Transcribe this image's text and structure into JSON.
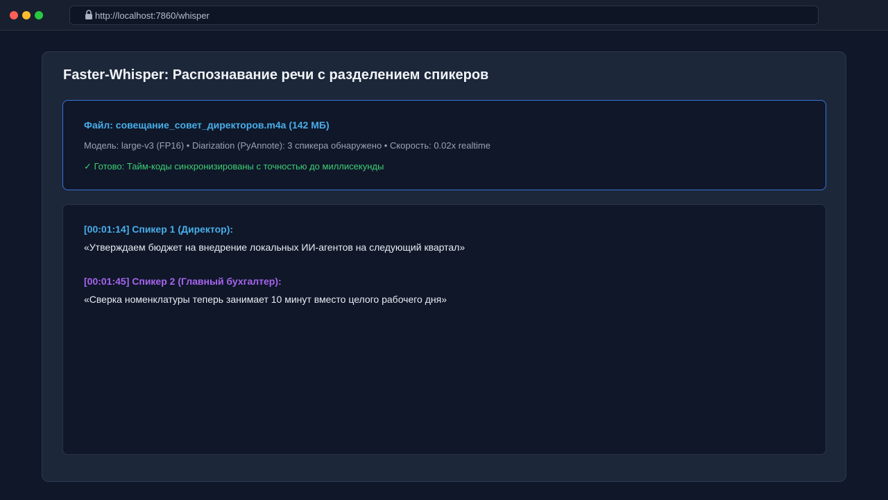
{
  "browser": {
    "url": "http://localhost:7860/whisper",
    "colors": {
      "close": "#ff5f57",
      "minimize": "#febc2e",
      "zoom": "#28c840"
    }
  },
  "app": {
    "title": "Faster-Whisper: Распознавание речи с разделением спикеров",
    "status": {
      "file_label": "Файл: совещание_совет_директоров.m4a (142 МБ)",
      "meta": "Модель: large-v3 (FP16) • Diarization (PyAnnote): 3 спикера обнаружено • Скорость: 0.02x realtime",
      "done": "✓ Готово: Тайм-коды синхронизированы с точностью до миллисекунды"
    },
    "transcript": [
      {
        "header": "[00:01:14] Спикер 1 (Директор):",
        "text": "«Утверждаем бюджет на внедрение локальных ИИ-агентов на следующий квартал»",
        "color": "#49aee9"
      },
      {
        "header": "[00:01:45] Спикер 2 (Главный бухгалтер):",
        "text": "«Сверка номенклатуры теперь занимает 10 минут вместо целого рабочего дня»",
        "color": "#a865ef"
      }
    ]
  }
}
